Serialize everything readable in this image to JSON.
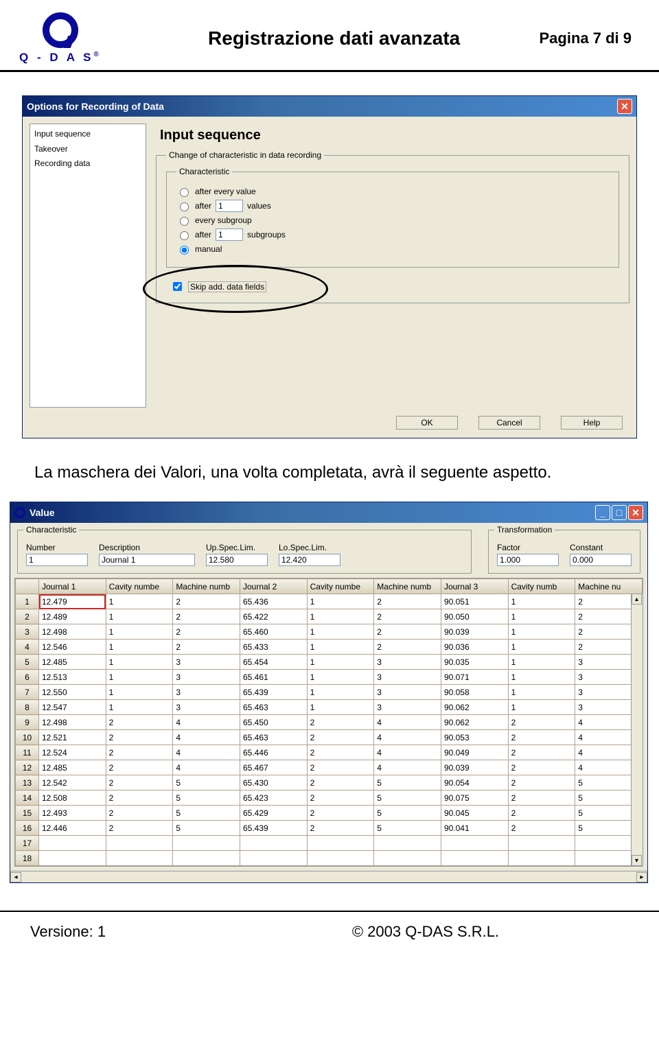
{
  "header": {
    "logo_text": "Q - D A S",
    "title": "Registrazione dati avanzata",
    "page": "Pagina 7 di 9"
  },
  "dialog1": {
    "title": "Options for Recording of Data",
    "tree": [
      "Input sequence",
      "Takeover",
      "Recording data"
    ],
    "panel_heading": "Input sequence",
    "fs_change": "Change of characteristic in data recording",
    "fs_char": "Characteristic",
    "opt_every_value": "after every value",
    "opt_after1": "after",
    "val1": "1",
    "lbl_values": "values",
    "opt_every_sub": "every subgroup",
    "opt_after2": "after",
    "val2": "1",
    "lbl_subgroups": "subgroups",
    "opt_manual": "manual",
    "chk_skip": "Skip add. data fields",
    "btn_ok": "OK",
    "btn_cancel": "Cancel",
    "btn_help": "Help"
  },
  "body_text": "La maschera dei Valori, una volta completata, avrà il seguente aspetto.",
  "dialog2": {
    "title": "Value",
    "grp_char": "Characteristic",
    "grp_trans": "Transformation",
    "fields": {
      "number_lbl": "Number",
      "number_val": "1",
      "desc_lbl": "Description",
      "desc_val": "Journal 1",
      "usl_lbl": "Up.Spec.Lim.",
      "usl_val": "12.580",
      "lsl_lbl": "Lo.Spec.Lim.",
      "lsl_val": "12.420",
      "factor_lbl": "Factor",
      "factor_val": "1.000",
      "const_lbl": "Constant",
      "const_val": "0.000"
    },
    "columns": [
      "",
      "Journal 1",
      "Cavity numbe",
      "Machine numb",
      "Journal 2",
      "Cavity numbe",
      "Machine numb",
      "Journal 3",
      "Cavity numb",
      "Machine nu"
    ],
    "rows": [
      [
        "1",
        "12.479",
        "1",
        "2",
        "65.436",
        "1",
        "2",
        "90.051",
        "1",
        "2"
      ],
      [
        "2",
        "12.489",
        "1",
        "2",
        "65.422",
        "1",
        "2",
        "90.050",
        "1",
        "2"
      ],
      [
        "3",
        "12.498",
        "1",
        "2",
        "65.460",
        "1",
        "2",
        "90.039",
        "1",
        "2"
      ],
      [
        "4",
        "12.546",
        "1",
        "2",
        "65.433",
        "1",
        "2",
        "90.036",
        "1",
        "2"
      ],
      [
        "5",
        "12.485",
        "1",
        "3",
        "65.454",
        "1",
        "3",
        "90.035",
        "1",
        "3"
      ],
      [
        "6",
        "12.513",
        "1",
        "3",
        "65.461",
        "1",
        "3",
        "90.071",
        "1",
        "3"
      ],
      [
        "7",
        "12.550",
        "1",
        "3",
        "65.439",
        "1",
        "3",
        "90.058",
        "1",
        "3"
      ],
      [
        "8",
        "12.547",
        "1",
        "3",
        "65.463",
        "1",
        "3",
        "90.062",
        "1",
        "3"
      ],
      [
        "9",
        "12.498",
        "2",
        "4",
        "65.450",
        "2",
        "4",
        "90.062",
        "2",
        "4"
      ],
      [
        "10",
        "12.521",
        "2",
        "4",
        "65.463",
        "2",
        "4",
        "90.053",
        "2",
        "4"
      ],
      [
        "11",
        "12.524",
        "2",
        "4",
        "65.446",
        "2",
        "4",
        "90.049",
        "2",
        "4"
      ],
      [
        "12",
        "12.485",
        "2",
        "4",
        "65.467",
        "2",
        "4",
        "90.039",
        "2",
        "4"
      ],
      [
        "13",
        "12.542",
        "2",
        "5",
        "65.430",
        "2",
        "5",
        "90.054",
        "2",
        "5"
      ],
      [
        "14",
        "12.508",
        "2",
        "5",
        "65.423",
        "2",
        "5",
        "90.075",
        "2",
        "5"
      ],
      [
        "15",
        "12.493",
        "2",
        "5",
        "65.429",
        "2",
        "5",
        "90.045",
        "2",
        "5"
      ],
      [
        "16",
        "12.446",
        "2",
        "5",
        "65.439",
        "2",
        "5",
        "90.041",
        "2",
        "5"
      ],
      [
        "17",
        "",
        "",
        "",
        "",
        "",
        "",
        "",
        "",
        ""
      ],
      [
        "18",
        "",
        "",
        "",
        "",
        "",
        "",
        "",
        "",
        ""
      ]
    ]
  },
  "footer": {
    "version": "Versione: 1",
    "copyright": "© 2003 Q-DAS S.R.L."
  }
}
